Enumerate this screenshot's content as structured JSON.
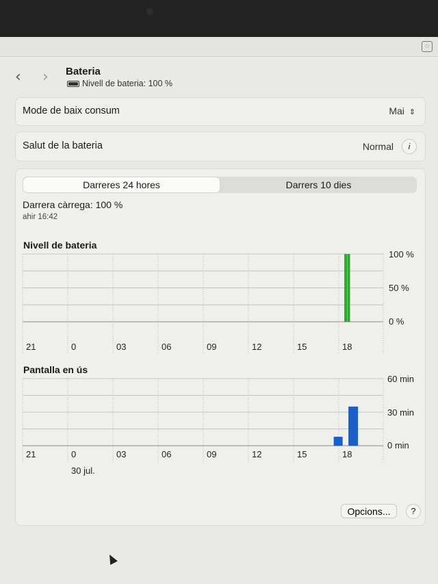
{
  "window": {
    "title": "Bateria",
    "subtitle": "Nivell de bateria: 100 %"
  },
  "settings": {
    "low_power_mode": {
      "label": "Mode de baix consum",
      "value": "Mai"
    },
    "battery_health": {
      "label": "Salut de la bateria",
      "value": "Normal"
    }
  },
  "tabs": {
    "active": "Darreres 24 hores",
    "inactive": "Darrers 10 dies"
  },
  "last_charge": {
    "label": "Darrera càrrega: 100 %",
    "time": "ahir 16:42"
  },
  "chart_data": [
    {
      "type": "bar",
      "title": "Nivell de bateria",
      "categories": [
        "21",
        "0",
        "03",
        "06",
        "09",
        "12",
        "15",
        "18"
      ],
      "y_ticks": [
        "100 %",
        "50 %",
        "0 %"
      ],
      "ylim": [
        0,
        100
      ],
      "bars": [
        {
          "hour": 18.5,
          "value": 100
        },
        {
          "hour": 18.7,
          "value": 100
        }
      ],
      "color": "#2fa832"
    },
    {
      "type": "bar",
      "title": "Pantalla en ús",
      "categories": [
        "21",
        "0",
        "03",
        "06",
        "09",
        "12",
        "15",
        "18"
      ],
      "date_label": "30 jul.",
      "y_ticks": [
        "60 min",
        "30 min",
        "0 min"
      ],
      "ylim": [
        0,
        60
      ],
      "bars": [
        {
          "hour": 18.0,
          "value": 8
        },
        {
          "hour": 19.0,
          "value": 35
        }
      ],
      "color": "#1a5fc7"
    }
  ],
  "footer": {
    "options_label": "Opcions...",
    "help_label": "?"
  }
}
